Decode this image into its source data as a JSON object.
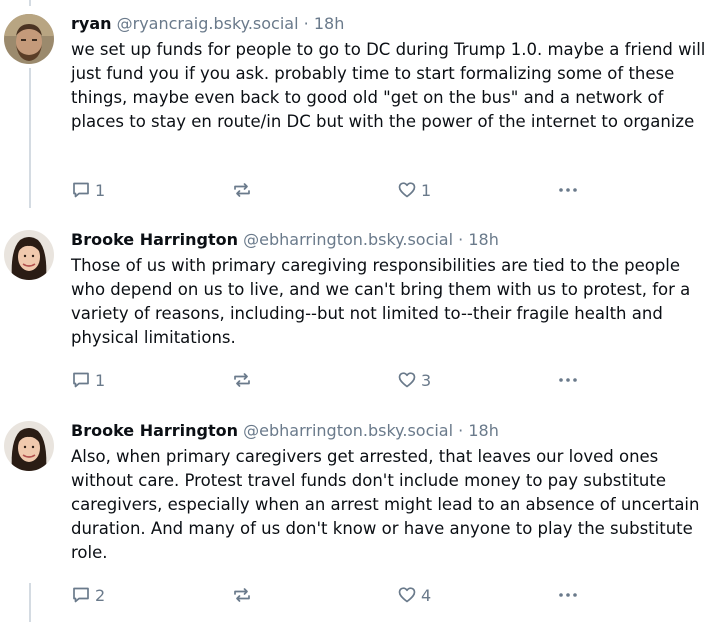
{
  "posts": [
    {
      "author": "ryan",
      "handle": "@ryancraig.bsky.social",
      "sep": "·",
      "time": "18h",
      "text": "we set up funds for people to go to DC during Trump 1.0. maybe a friend will just fund you if you ask. probably time to start formalizing some of these things, maybe even back to good old \"get on the bus\" and a network of places to stay en route/in DC but with the power of the internet to organize",
      "replies": "1",
      "likes": "1"
    },
    {
      "author": "Brooke Harrington",
      "handle": "@ebharrington.bsky.social",
      "sep": "·",
      "time": "18h",
      "text": "Those of us with primary caregiving responsibilities are tied to the people who depend on us to live, and we can't bring them with us to protest, for a variety of reasons, including--but not limited to--their fragile health and physical limitations.",
      "replies": "1",
      "likes": "3"
    },
    {
      "author": "Brooke Harrington",
      "handle": "@ebharrington.bsky.social",
      "sep": "·",
      "time": "18h",
      "text": "Also, when primary caregivers get arrested, that leaves our loved ones without care. Protest travel funds don't include money to pay substitute caregivers, especially when an arrest might lead to an absence of uncertain duration. And many of us don't know or have anyone to play the substitute role.",
      "replies": "2",
      "likes": "4"
    }
  ],
  "icons": {
    "reply": "reply-icon",
    "repost": "repost-icon",
    "like": "heart-icon",
    "more": "more-icon"
  },
  "colors": {
    "text": "#0b0f14",
    "muted": "#6a7a8b",
    "thread_line": "#d4dbe2"
  }
}
